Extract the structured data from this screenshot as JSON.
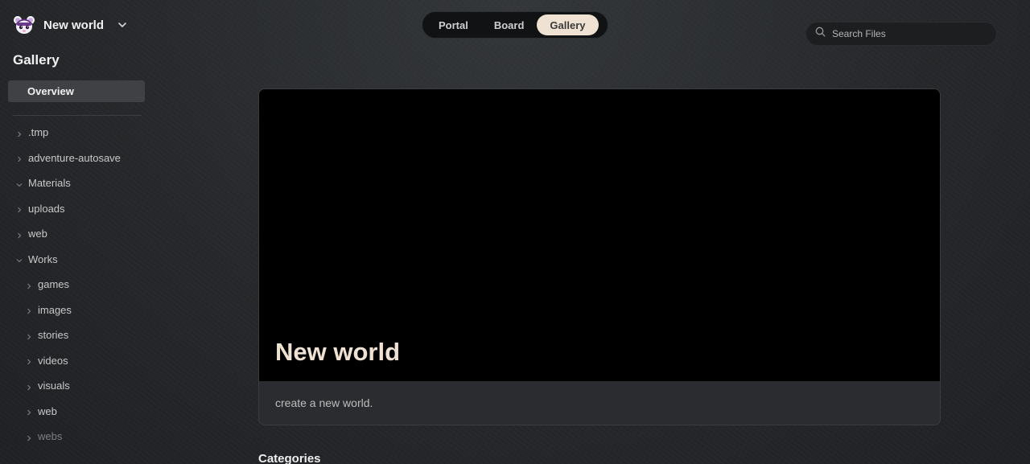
{
  "workspace": {
    "name": "New world"
  },
  "sidebar": {
    "section_title": "Gallery",
    "overview_label": "Overview",
    "tree": [
      {
        "label": ".tmp",
        "expanded": false,
        "level": 0
      },
      {
        "label": "adventure-autosave",
        "expanded": false,
        "level": 0
      },
      {
        "label": "Materials",
        "expanded": true,
        "level": 0
      },
      {
        "label": "uploads",
        "expanded": false,
        "level": 0
      },
      {
        "label": "web",
        "expanded": false,
        "level": 0
      },
      {
        "label": "Works",
        "expanded": true,
        "level": 0
      },
      {
        "label": "games",
        "expanded": false,
        "level": 1
      },
      {
        "label": "images",
        "expanded": false,
        "level": 1
      },
      {
        "label": "stories",
        "expanded": false,
        "level": 1
      },
      {
        "label": "videos",
        "expanded": false,
        "level": 1
      },
      {
        "label": "visuals",
        "expanded": false,
        "level": 1
      },
      {
        "label": "web",
        "expanded": false,
        "level": 1
      },
      {
        "label": "webs",
        "expanded": false,
        "level": 1
      }
    ]
  },
  "tabs": [
    {
      "label": "Portal",
      "active": false
    },
    {
      "label": "Board",
      "active": false
    },
    {
      "label": "Gallery",
      "active": true
    }
  ],
  "search": {
    "placeholder": "Search Files",
    "value": ""
  },
  "card": {
    "title": "New world",
    "description": "create a new world."
  },
  "categories_heading": "Categories",
  "colors": {
    "accent": "#efe2d3",
    "background": "#26282b",
    "hero": "#000000"
  }
}
